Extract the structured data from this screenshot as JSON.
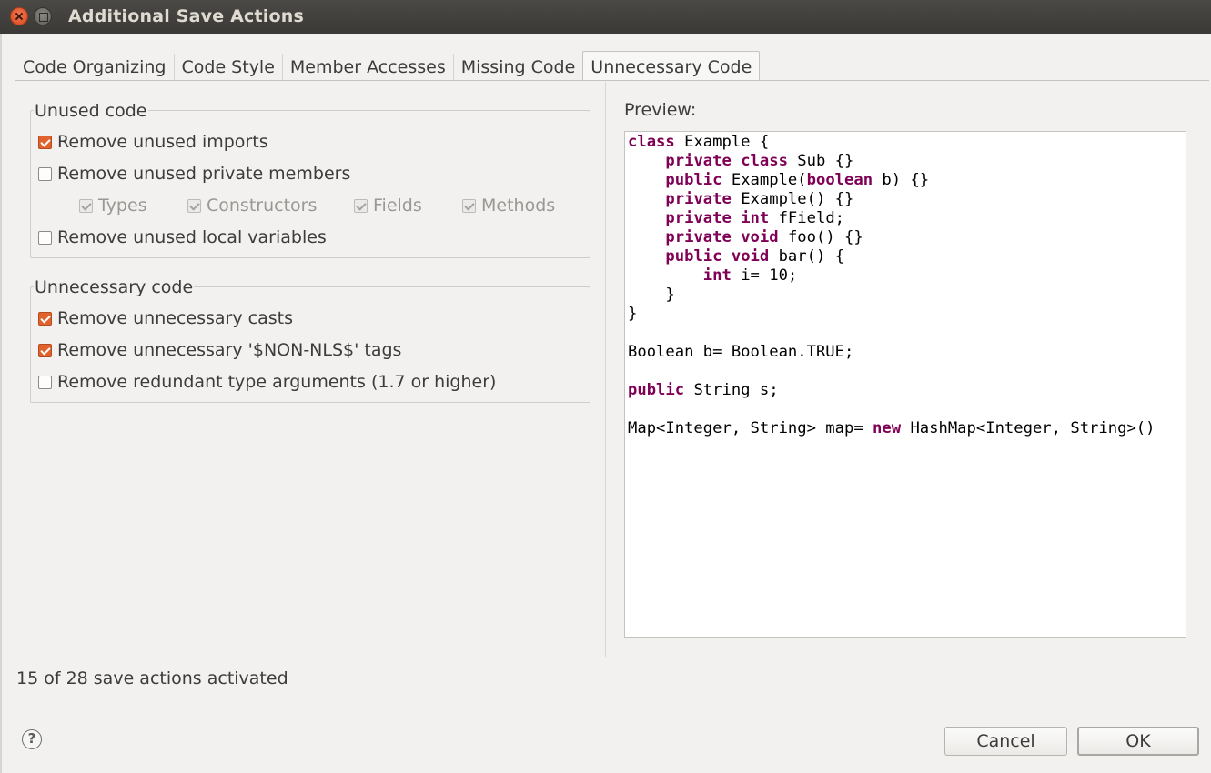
{
  "window": {
    "title": "Additional Save Actions"
  },
  "tabs": [
    {
      "label": "Code Organizing",
      "active": false
    },
    {
      "label": "Code Style",
      "active": false
    },
    {
      "label": "Member Accesses",
      "active": false
    },
    {
      "label": "Missing Code",
      "active": false
    },
    {
      "label": "Unnecessary Code",
      "active": true
    }
  ],
  "unused_code": {
    "title": "Unused code",
    "remove_unused_imports": {
      "label": "Remove unused imports",
      "checked": true
    },
    "remove_unused_private_members": {
      "label": "Remove unused private members",
      "checked": false
    },
    "member_types": [
      {
        "label": "Types",
        "checked": true,
        "enabled": false
      },
      {
        "label": "Constructors",
        "checked": true,
        "enabled": false
      },
      {
        "label": "Fields",
        "checked": true,
        "enabled": false
      },
      {
        "label": "Methods",
        "checked": true,
        "enabled": false
      }
    ],
    "remove_unused_local_variables": {
      "label": "Remove unused local variables",
      "checked": false
    }
  },
  "unnecessary_code": {
    "title": "Unnecessary code",
    "remove_unnecessary_casts": {
      "label": "Remove unnecessary casts",
      "checked": true
    },
    "remove_nls_tags": {
      "label": "Remove unnecessary '$NON-NLS$' tags",
      "checked": true
    },
    "remove_redundant_type_arguments": {
      "label": "Remove redundant type arguments (1.7 or higher)",
      "checked": false
    }
  },
  "preview": {
    "label": "Preview:",
    "code_lines": [
      [
        [
          "kw",
          "class"
        ],
        [
          "t",
          " Example {"
        ]
      ],
      [
        [
          "t",
          "    "
        ],
        [
          "kw",
          "private class"
        ],
        [
          "t",
          " Sub {}"
        ]
      ],
      [
        [
          "t",
          "    "
        ],
        [
          "kw",
          "public"
        ],
        [
          "t",
          " Example("
        ],
        [
          "kw",
          "boolean"
        ],
        [
          "t",
          " b) {}"
        ]
      ],
      [
        [
          "t",
          "    "
        ],
        [
          "kw",
          "private"
        ],
        [
          "t",
          " Example() {}"
        ]
      ],
      [
        [
          "t",
          "    "
        ],
        [
          "kw",
          "private int"
        ],
        [
          "t",
          " fField;"
        ]
      ],
      [
        [
          "t",
          "    "
        ],
        [
          "kw",
          "private void"
        ],
        [
          "t",
          " foo() {}"
        ]
      ],
      [
        [
          "t",
          "    "
        ],
        [
          "kw",
          "public void"
        ],
        [
          "t",
          " bar() {"
        ]
      ],
      [
        [
          "t",
          "        "
        ],
        [
          "kw",
          "int"
        ],
        [
          "t",
          " i= 10;"
        ]
      ],
      [
        [
          "t",
          "    }"
        ]
      ],
      [
        [
          "t",
          "}"
        ]
      ],
      [
        [
          "t",
          ""
        ]
      ],
      [
        [
          "t",
          "Boolean b= Boolean.TRUE;"
        ]
      ],
      [
        [
          "t",
          ""
        ]
      ],
      [
        [
          "kw",
          "public"
        ],
        [
          "t",
          " String s;"
        ]
      ],
      [
        [
          "t",
          ""
        ]
      ],
      [
        [
          "t",
          "Map<Integer, String> map= "
        ],
        [
          "kw",
          "new"
        ],
        [
          "t",
          " HashMap<Integer, String>()"
        ]
      ]
    ]
  },
  "status": {
    "text": "15 of 28 save actions activated"
  },
  "buttons": {
    "help": "?",
    "cancel": "Cancel",
    "ok": "OK"
  },
  "colors": {
    "accent": "#e0622d",
    "keyword": "#7f0055",
    "titlebar": "#3d3c38"
  }
}
